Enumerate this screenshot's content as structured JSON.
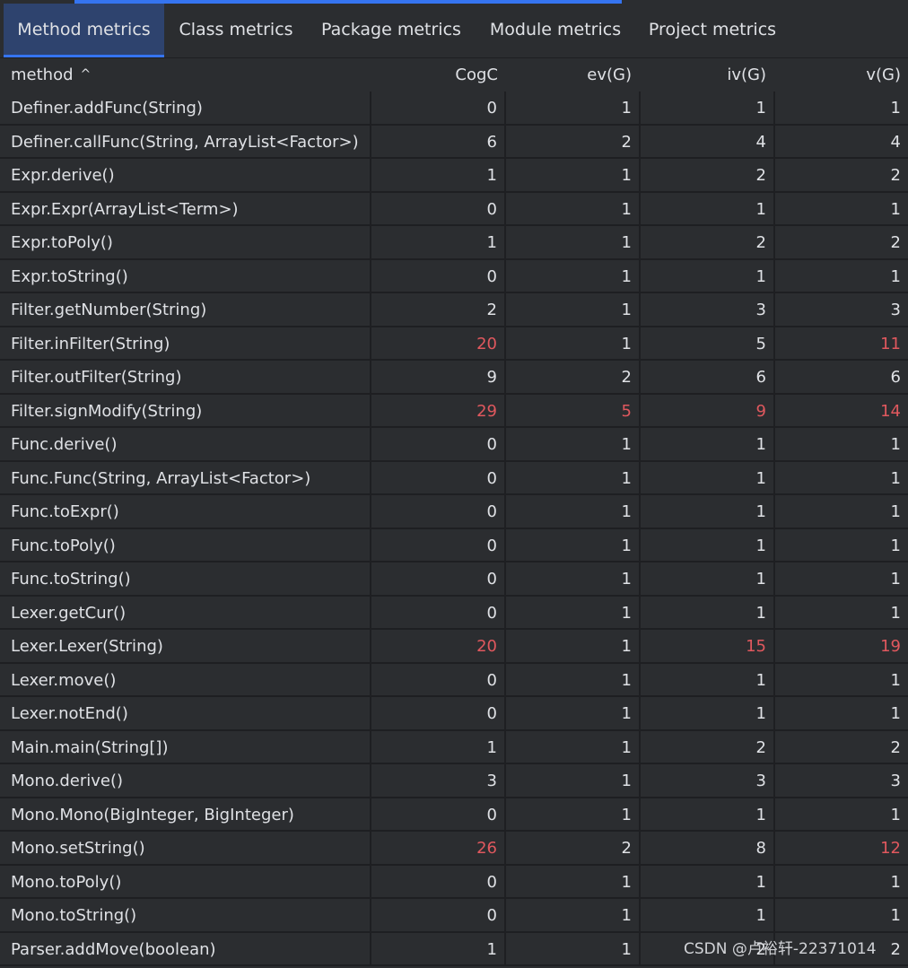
{
  "tabs": [
    {
      "label": "Method metrics",
      "active": true
    },
    {
      "label": "Class metrics",
      "active": false
    },
    {
      "label": "Package metrics",
      "active": false
    },
    {
      "label": "Module metrics",
      "active": false
    },
    {
      "label": "Project metrics",
      "active": false
    }
  ],
  "table": {
    "columns": [
      "method",
      "CogC",
      "ev(G)",
      "iv(G)",
      "v(G)"
    ],
    "sort_indicator": "^",
    "rows": [
      {
        "method": "Definer.addFunc(String)",
        "cogc": "0",
        "evg": "1",
        "ivg": "1",
        "vg": "1",
        "red": []
      },
      {
        "method": "Definer.callFunc(String, ArrayList<Factor>)",
        "cogc": "6",
        "evg": "2",
        "ivg": "4",
        "vg": "4",
        "red": []
      },
      {
        "method": "Expr.derive()",
        "cogc": "1",
        "evg": "1",
        "ivg": "2",
        "vg": "2",
        "red": []
      },
      {
        "method": "Expr.Expr(ArrayList<Term>)",
        "cogc": "0",
        "evg": "1",
        "ivg": "1",
        "vg": "1",
        "red": []
      },
      {
        "method": "Expr.toPoly()",
        "cogc": "1",
        "evg": "1",
        "ivg": "2",
        "vg": "2",
        "red": []
      },
      {
        "method": "Expr.toString()",
        "cogc": "0",
        "evg": "1",
        "ivg": "1",
        "vg": "1",
        "red": []
      },
      {
        "method": "Filter.getNumber(String)",
        "cogc": "2",
        "evg": "1",
        "ivg": "3",
        "vg": "3",
        "red": []
      },
      {
        "method": "Filter.inFilter(String)",
        "cogc": "20",
        "evg": "1",
        "ivg": "5",
        "vg": "11",
        "red": [
          "cogc",
          "vg"
        ]
      },
      {
        "method": "Filter.outFilter(String)",
        "cogc": "9",
        "evg": "2",
        "ivg": "6",
        "vg": "6",
        "red": []
      },
      {
        "method": "Filter.signModify(String)",
        "cogc": "29",
        "evg": "5",
        "ivg": "9",
        "vg": "14",
        "red": [
          "cogc",
          "evg",
          "ivg",
          "vg"
        ]
      },
      {
        "method": "Func.derive()",
        "cogc": "0",
        "evg": "1",
        "ivg": "1",
        "vg": "1",
        "red": []
      },
      {
        "method": "Func.Func(String, ArrayList<Factor>)",
        "cogc": "0",
        "evg": "1",
        "ivg": "1",
        "vg": "1",
        "red": []
      },
      {
        "method": "Func.toExpr()",
        "cogc": "0",
        "evg": "1",
        "ivg": "1",
        "vg": "1",
        "red": []
      },
      {
        "method": "Func.toPoly()",
        "cogc": "0",
        "evg": "1",
        "ivg": "1",
        "vg": "1",
        "red": []
      },
      {
        "method": "Func.toString()",
        "cogc": "0",
        "evg": "1",
        "ivg": "1",
        "vg": "1",
        "red": []
      },
      {
        "method": "Lexer.getCur()",
        "cogc": "0",
        "evg": "1",
        "ivg": "1",
        "vg": "1",
        "red": []
      },
      {
        "method": "Lexer.Lexer(String)",
        "cogc": "20",
        "evg": "1",
        "ivg": "15",
        "vg": "19",
        "red": [
          "cogc",
          "ivg",
          "vg"
        ]
      },
      {
        "method": "Lexer.move()",
        "cogc": "0",
        "evg": "1",
        "ivg": "1",
        "vg": "1",
        "red": []
      },
      {
        "method": "Lexer.notEnd()",
        "cogc": "0",
        "evg": "1",
        "ivg": "1",
        "vg": "1",
        "red": []
      },
      {
        "method": "Main.main(String[])",
        "cogc": "1",
        "evg": "1",
        "ivg": "2",
        "vg": "2",
        "red": []
      },
      {
        "method": "Mono.derive()",
        "cogc": "3",
        "evg": "1",
        "ivg": "3",
        "vg": "3",
        "red": []
      },
      {
        "method": "Mono.Mono(BigInteger, BigInteger)",
        "cogc": "0",
        "evg": "1",
        "ivg": "1",
        "vg": "1",
        "red": []
      },
      {
        "method": "Mono.setString()",
        "cogc": "26",
        "evg": "2",
        "ivg": "8",
        "vg": "12",
        "red": [
          "cogc",
          "vg"
        ]
      },
      {
        "method": "Mono.toPoly()",
        "cogc": "0",
        "evg": "1",
        "ivg": "1",
        "vg": "1",
        "red": []
      },
      {
        "method": "Mono.toString()",
        "cogc": "0",
        "evg": "1",
        "ivg": "1",
        "vg": "1",
        "red": []
      },
      {
        "method": "Parser.addMove(boolean)",
        "cogc": "1",
        "evg": "1",
        "ivg": "2",
        "vg": "2",
        "red": []
      }
    ]
  },
  "watermark": "CSDN @卢裕轩-22371014",
  "colors": {
    "accent": "#3574f0",
    "warning": "#e0585e",
    "background": "#2b2d30",
    "grid_line": "#1e1f22",
    "active_tab": "#2e436e"
  }
}
